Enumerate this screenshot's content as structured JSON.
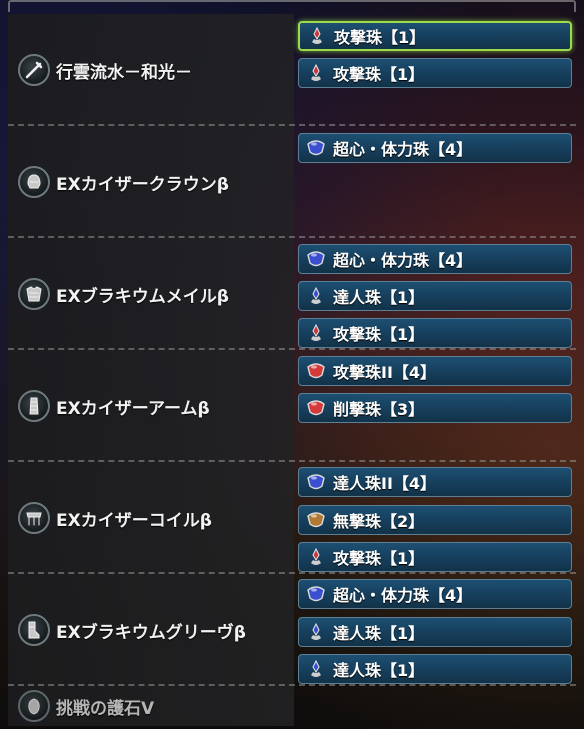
{
  "colors": {
    "slot_bg": "#1d4f72",
    "slot_border": "#5c7f96",
    "selected_border": "#9edb48",
    "lv1_icon": "#c8383c",
    "lv4_blue": "#3a4fcf",
    "lv4_red": "#d43a3a",
    "lv2_bronze": "#b07a35",
    "divider": "#969696"
  },
  "equipment": [
    {
      "name": "行雲流水－和光－",
      "icon": "weapon-icon",
      "slots": [
        {
          "label": "攻撃珠【1】",
          "icon": "decoration-lv1-red-icon",
          "selected": true
        },
        {
          "label": "攻撃珠【1】",
          "icon": "decoration-lv1-red-icon",
          "selected": false
        }
      ]
    },
    {
      "name": "EXカイザークラウンβ",
      "icon": "helm-icon",
      "slots": [
        {
          "label": "超心・体力珠【4】",
          "icon": "decoration-lv4-blue-icon",
          "selected": false
        }
      ]
    },
    {
      "name": "EXブラキウムメイルβ",
      "icon": "chest-armor-icon",
      "slots": [
        {
          "label": "超心・体力珠【4】",
          "icon": "decoration-lv4-blue-icon",
          "selected": false
        },
        {
          "label": "達人珠【1】",
          "icon": "decoration-lv1-blue-icon",
          "selected": false
        },
        {
          "label": "攻撃珠【1】",
          "icon": "decoration-lv1-red-icon",
          "selected": false
        }
      ]
    },
    {
      "name": "EXカイザーアームβ",
      "icon": "arm-armor-icon",
      "slots": [
        {
          "label": "攻撃珠II【4】",
          "icon": "decoration-lv4-red-icon",
          "selected": false
        },
        {
          "label": "削撃珠【3】",
          "icon": "decoration-lv3-red-icon",
          "selected": false
        }
      ]
    },
    {
      "name": "EXカイザーコイルβ",
      "icon": "waist-armor-icon",
      "slots": [
        {
          "label": "達人珠II【4】",
          "icon": "decoration-lv4-blue-icon",
          "selected": false
        },
        {
          "label": "無撃珠【2】",
          "icon": "decoration-lv2-bronze-icon",
          "selected": false
        },
        {
          "label": "攻撃珠【1】",
          "icon": "decoration-lv1-red-icon",
          "selected": false
        }
      ]
    },
    {
      "name": "EXブラキウムグリーヴβ",
      "icon": "leg-armor-icon",
      "slots": [
        {
          "label": "超心・体力珠【4】",
          "icon": "decoration-lv4-blue-icon",
          "selected": false
        },
        {
          "label": "達人珠【1】",
          "icon": "decoration-lv1-blue-icon",
          "selected": false
        },
        {
          "label": "達人珠【1】",
          "icon": "decoration-lv1-blue-icon",
          "selected": false
        }
      ]
    },
    {
      "name": "挑戦の護石V",
      "icon": "charm-icon",
      "slots": []
    }
  ]
}
